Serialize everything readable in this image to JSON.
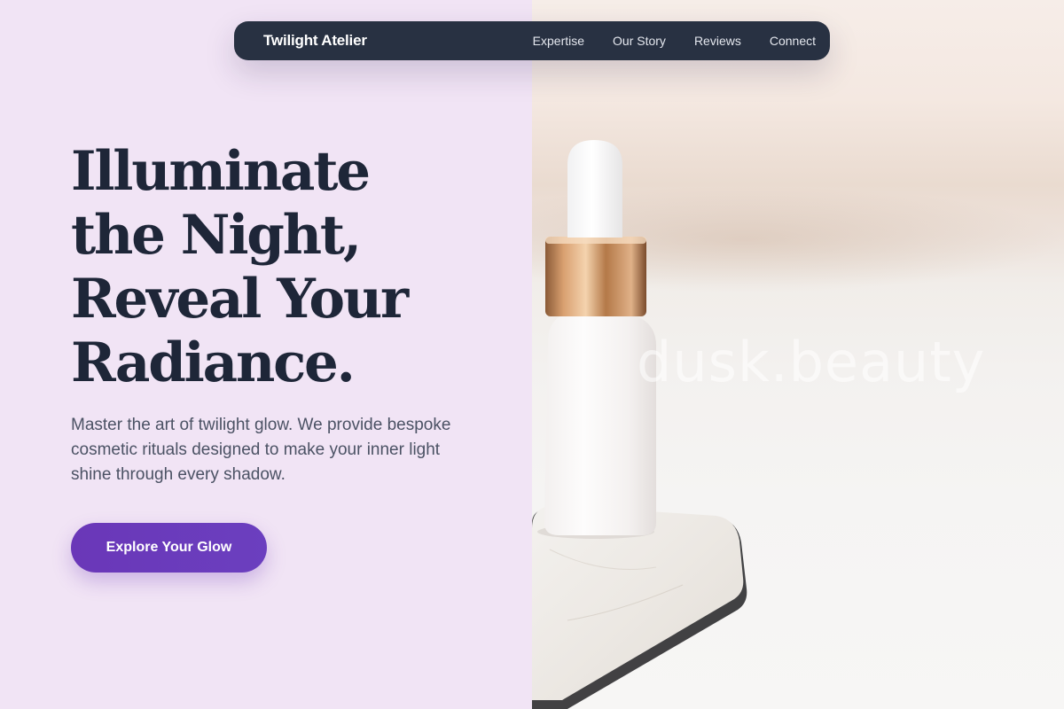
{
  "nav": {
    "brand": "Twilight Atelier",
    "links": [
      {
        "label": "Expertise"
      },
      {
        "label": "Our Story"
      },
      {
        "label": "Reviews"
      },
      {
        "label": "Connect"
      }
    ]
  },
  "hero": {
    "title_lines": [
      "Illuminate",
      "the Night,",
      "Reveal Your",
      "Radiance."
    ],
    "subtitle": "Master the art of twilight glow. We provide bespoke cosmetic rituals designed to make your inner light shine through every shadow.",
    "cta_label": "Explore Your Glow"
  },
  "image": {
    "watermark": "dusk.beauty",
    "subject": "white serum dropper bottle with gold collar on marble stand"
  },
  "colors": {
    "left_background": "#f1e4f5",
    "nav_background": "#283142",
    "heading": "#1e2638",
    "body_text": "#4b5264",
    "accent": "#6a37b8"
  }
}
